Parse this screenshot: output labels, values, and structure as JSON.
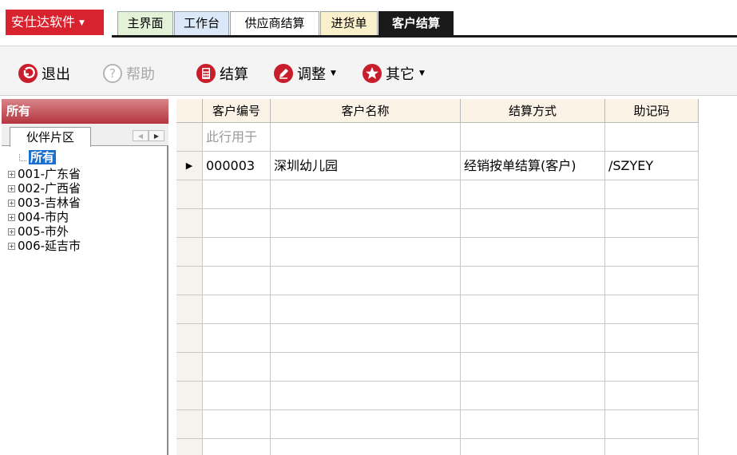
{
  "app": {
    "brand_label": "安仕达软件",
    "tabs": [
      {
        "label": "主界面"
      },
      {
        "label": "工作台"
      },
      {
        "label": "供应商结算"
      },
      {
        "label": "进货单"
      },
      {
        "label": "客户结算"
      }
    ]
  },
  "toolbar": {
    "exit_label": "退出",
    "help_label": "帮助",
    "settle_label": "结算",
    "adjust_label": "调整",
    "other_label": "其它"
  },
  "left_panel": {
    "title": "所有",
    "tab_label": "伙伴片区",
    "tree": {
      "root": "所有",
      "items": [
        {
          "label": "001-广东省"
        },
        {
          "label": "002-广西省"
        },
        {
          "label": "003-吉林省"
        },
        {
          "label": "004-市内"
        },
        {
          "label": "005-市外"
        },
        {
          "label": "006-延吉市"
        }
      ]
    }
  },
  "grid": {
    "columns": [
      "客户编号",
      "客户名称",
      "结算方式",
      "助记码"
    ],
    "filter_row": {
      "placeholder": "此行用于"
    },
    "rows": [
      {
        "code": "000003",
        "name": "深圳幼儿园",
        "method": "经销按单结算(客户)",
        "mnemonic": "/SZYEY"
      }
    ]
  },
  "colors": {
    "brand": "#d8222d",
    "active_tab": "#1a1a1a",
    "tree_selection": "#1c6fd0"
  }
}
